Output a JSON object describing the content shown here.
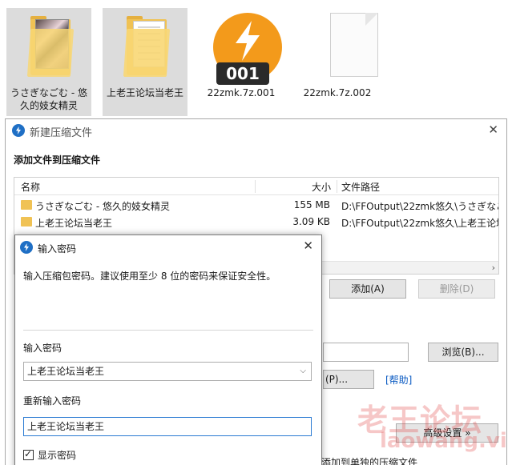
{
  "desktop": {
    "icons": [
      {
        "label": "うさぎなごむ - 悠久的妓女精灵"
      },
      {
        "label": "上老王论坛当老王"
      },
      {
        "label": "22zmk.7z.001",
        "badge": "001"
      },
      {
        "label": "22zmk.7z.002"
      }
    ]
  },
  "archive_dialog": {
    "title": "新建压缩文件",
    "section_title": "添加文件到压缩文件",
    "columns": {
      "name": "名称",
      "size": "大小",
      "path": "文件路径"
    },
    "files": [
      {
        "name": "うさぎなごむ - 悠久的妓女精灵",
        "size": "155 MB",
        "path": "D:\\FFOutput\\22zmk悠久\\うさぎなご"
      },
      {
        "name": "上老王论坛当老王",
        "size": "3.09 KB",
        "path": "D:\\FFOutput\\22zmk悠久\\上老王论坛当"
      }
    ],
    "buttons": {
      "add": "添加(A)",
      "delete": "删除(D)",
      "browse": "浏览(B)...",
      "password_partial": "(P)...",
      "help": "[帮助]",
      "advanced": "高级设置 »"
    },
    "partial_text": "添加到单独的压缩文件",
    "close_symbol": "✕"
  },
  "password_dialog": {
    "title": "输入密码",
    "hint": "输入压缩包密码。建议使用至少 8 位的密码来保证安全性。",
    "password_label": "输入密码",
    "password_value": "上老王论坛当老王",
    "confirm_label": "重新输入密码",
    "confirm_value": "上老王论坛当老王",
    "show_password_label": "显示密码",
    "show_password_checked": true,
    "close_symbol": "✕"
  },
  "watermark": {
    "cn": "老王论坛",
    "en": "laowang.vip"
  },
  "colors": {
    "accent": "#1f6fc5",
    "folder": "#f0c254",
    "orange": "#f39a1b"
  }
}
